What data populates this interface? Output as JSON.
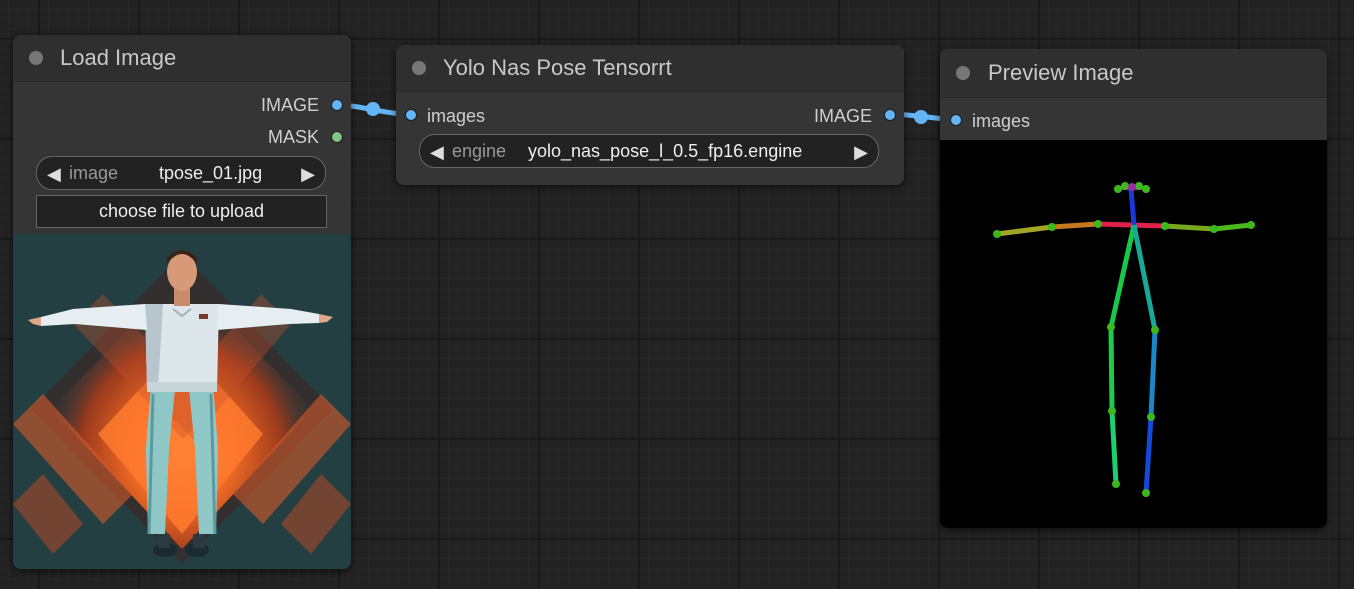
{
  "nodes": {
    "load_image": {
      "title": "Load Image",
      "outputs": [
        "IMAGE",
        "MASK"
      ],
      "widget_label": "image",
      "widget_value": "tpose_01.jpg",
      "upload_label": "choose file to upload"
    },
    "yolo": {
      "title": "Yolo Nas Pose Tensorrt",
      "input": "images",
      "output": "IMAGE",
      "widget_label": "engine",
      "widget_value": "yolo_nas_pose_l_0.5_fp16.engine"
    },
    "preview": {
      "title": "Preview Image",
      "input": "images"
    }
  },
  "colors": {
    "image_slot": "#64b5f6",
    "mask_slot": "#81c784",
    "link": "#64b5f6",
    "canvas_bg": "#222222",
    "node_bg": "#353535"
  },
  "icons": {
    "widget_left": "left-arrow-icon",
    "widget_right": "right-arrow-icon",
    "status_dot": "node-status-dot-icon"
  }
}
